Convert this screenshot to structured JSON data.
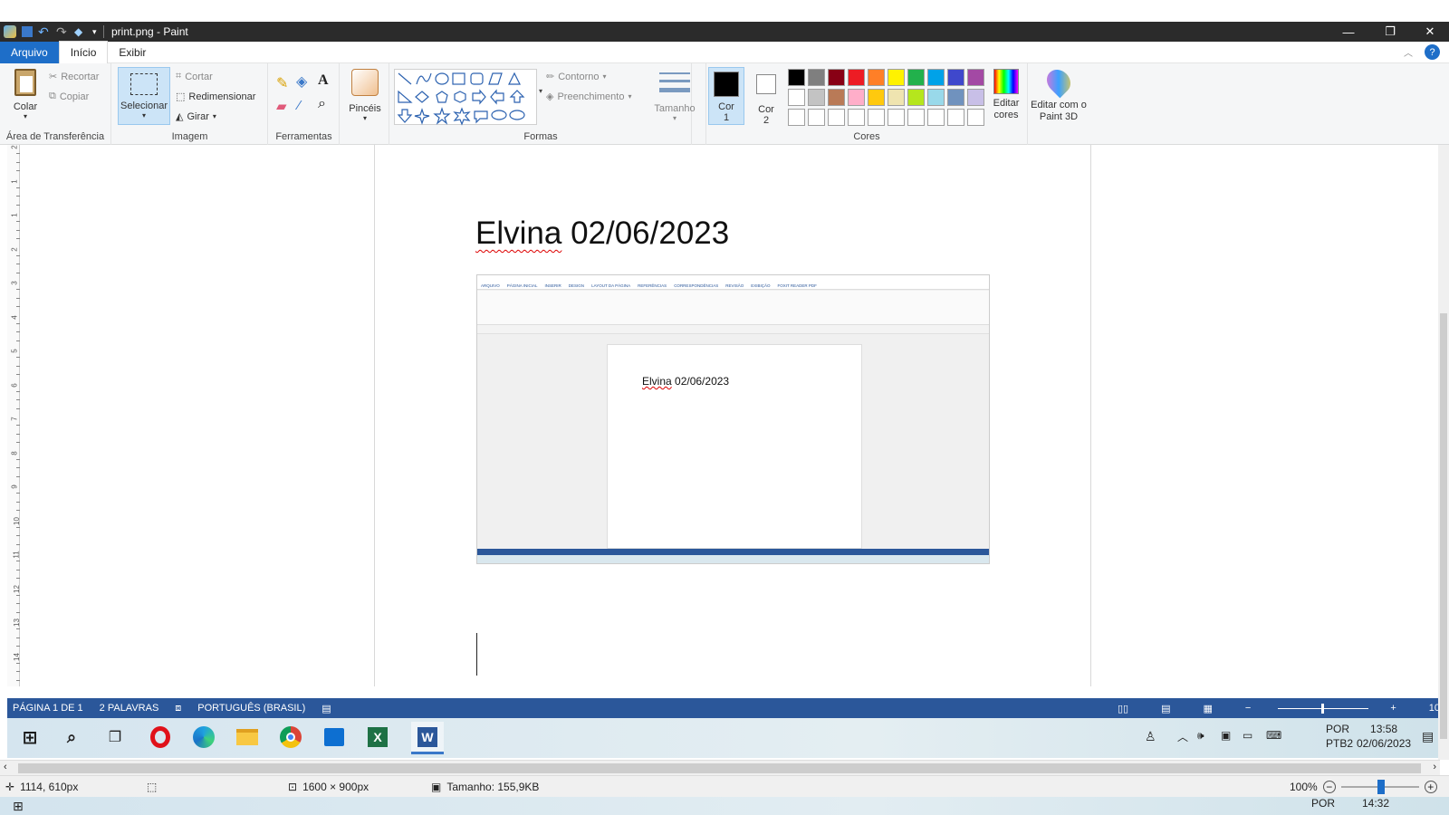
{
  "window": {
    "title": "print.png - Paint"
  },
  "menu": {
    "file": "Arquivo",
    "home": "Início",
    "view": "Exibir"
  },
  "ribbon": {
    "clipboard": {
      "paste": "Colar",
      "cut": "Recortar",
      "copy": "Copiar",
      "label": "Área de Transferência"
    },
    "image": {
      "select": "Selecionar",
      "crop": "Cortar",
      "resize": "Redimensionar",
      "rotate": "Girar",
      "label": "Imagem"
    },
    "tools": {
      "label": "Ferramentas"
    },
    "brushes": {
      "label": "Pincéis"
    },
    "shapes": {
      "outline": "Contorno",
      "fill": "Preenchimento",
      "label": "Formas"
    },
    "size": {
      "label": "Tamanho"
    },
    "colors": {
      "color1": "Cor",
      "color1_num": "1",
      "color2": "Cor",
      "color2_num": "2",
      "edit": "Editar cores",
      "label": "Cores",
      "palette_row1": [
        "#000000",
        "#7f7f7f",
        "#880015",
        "#ed1c24",
        "#ff7f27",
        "#fff200",
        "#22b14c",
        "#00a2e8",
        "#3f48cc",
        "#a349a4"
      ],
      "palette_row2": [
        "#ffffff",
        "#c3c3c3",
        "#b97a57",
        "#ffaec9",
        "#ffc90e",
        "#efe4b0",
        "#b5e61d",
        "#99d9ea",
        "#7092be",
        "#c8bfe7"
      ]
    },
    "paint3d": {
      "label": "Editar com o Paint 3D"
    }
  },
  "canvas": {
    "heading_name": "Elvina",
    "heading_date": "02/06/2023",
    "ruler_marks": [
      "2",
      "1",
      "1",
      "2",
      "3",
      "4",
      "5",
      "6",
      "7",
      "8",
      "9",
      "10",
      "11",
      "12",
      "13",
      "14"
    ]
  },
  "embedded": {
    "tabs": [
      "ARQUIVO",
      "PÁGINA INICIAL",
      "INSERIR",
      "DESIGN",
      "LAYOUT DA PÁGINA",
      "REFERÊNCIAS",
      "CORRESPONDÊNCIAS",
      "REVISÃO",
      "EXIBIÇÃO",
      "FOXIT READER PDF"
    ],
    "doc_name": "Elvina",
    "doc_date": "02/06/2023"
  },
  "word_status": {
    "page": "PÁGINA 1 DE 1",
    "words": "2 PALAVRAS",
    "language": "PORTUGUÊS (BRASIL)",
    "zoom_partial": "10"
  },
  "taskbar_inner": {
    "lang1": "POR",
    "lang2": "PTB2",
    "time": "13:58",
    "date": "02/06/2023"
  },
  "paint_status": {
    "cursor_pos": "1114, 610px",
    "dimensions": "1600 × 900px",
    "size": "Tamanho: 155,9KB",
    "zoom": "100%"
  },
  "taskbar_outer": {
    "lang": "POR",
    "time": "14:32"
  }
}
